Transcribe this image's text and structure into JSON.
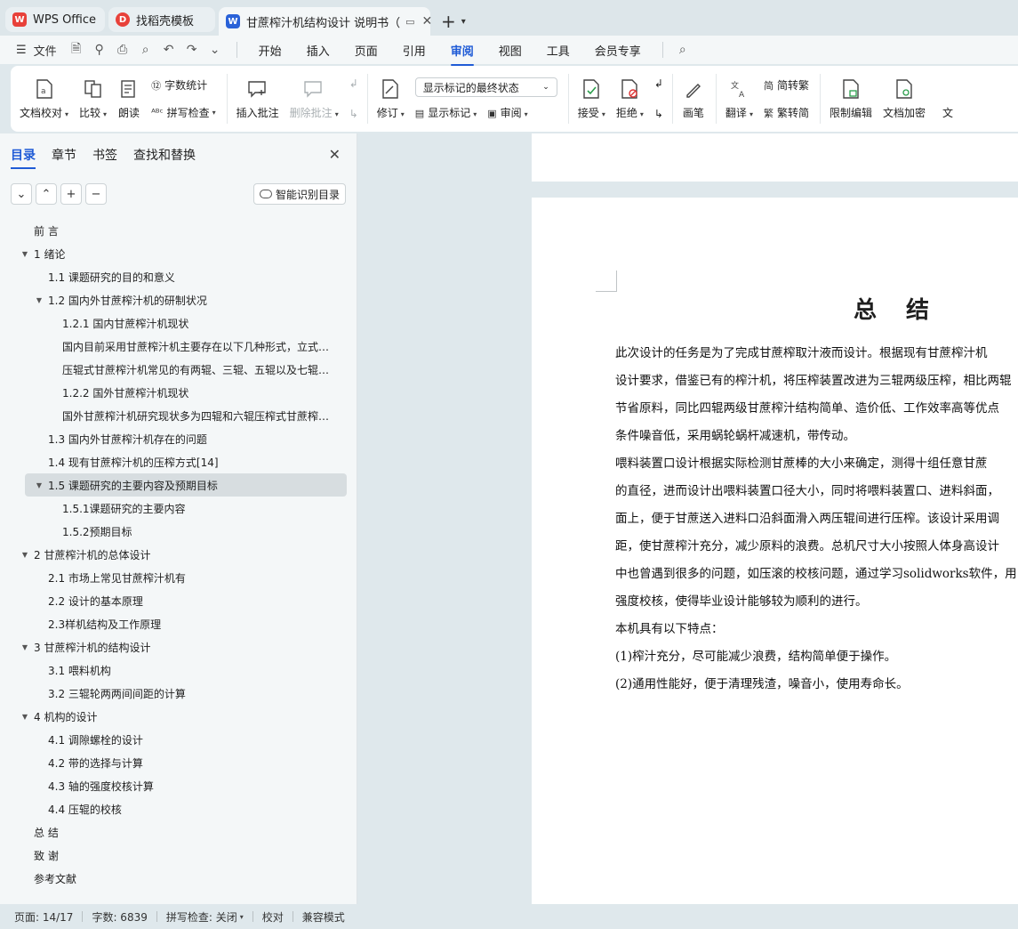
{
  "tabs": [
    {
      "label": "WPS Office",
      "icon": "wps-logo-icon"
    },
    {
      "label": "找稻壳模板",
      "icon": "daoke-logo-icon"
    },
    {
      "label": "甘蔗榨汁机结构设计 说明书（",
      "icon": "word-doc-icon"
    }
  ],
  "menu": {
    "file_label": "文件",
    "tabs": [
      "开始",
      "插入",
      "页面",
      "引用",
      "审阅",
      "视图",
      "工具",
      "会员专享"
    ],
    "active_tab": "审阅"
  },
  "ribbon": {
    "doc_check": "文档校对",
    "compare": "比较",
    "read_aloud": "朗读",
    "word_count": "字数统计",
    "spell_check": "拼写检查",
    "insert_comment": "插入批注",
    "delete_comment": "删除批注",
    "display_state": "显示标记的最终状态",
    "revise": "修订",
    "show_markup": "显示标记",
    "review": "审阅",
    "accept": "接受",
    "reject": "拒绝",
    "pen": "画笔",
    "translate": "翻译",
    "to_traditional": "简转繁",
    "to_simplified": "繁转简",
    "restrict_edit": "限制编辑",
    "encrypt": "文档加密",
    "more": "文"
  },
  "leftpane": {
    "tabs": [
      "目录",
      "章节",
      "书签",
      "查找和替换"
    ],
    "active_tab": "目录",
    "ai_button": "智能识别目录",
    "toc": [
      {
        "text": "前  言",
        "level": 1,
        "arrow": false
      },
      {
        "text": "1 绪论",
        "level": 1,
        "arrow": true
      },
      {
        "text": "1.1 课题研究的目的和意义",
        "level": 2,
        "arrow": false
      },
      {
        "text": "1.2 国内外甘蔗榨汁机的研制状况",
        "level": 2,
        "arrow": true
      },
      {
        "text": "1.2.1 国内甘蔗榨汁机现状",
        "level": 3,
        "arrow": false
      },
      {
        "text": "国内目前采用甘蔗榨汁机主要存在以下几种形式，立式…",
        "level": 3,
        "arrow": false
      },
      {
        "text": "压辊式甘蔗榨汁机常见的有两辊、三辊、五辊以及七辊…",
        "level": 3,
        "arrow": false
      },
      {
        "text": "1.2.2  国外甘蔗榨汁机现状",
        "level": 3,
        "arrow": false
      },
      {
        "text": "国外甘蔗榨汁机研究现状多为四辊和六辊压榨式甘蔗榨…",
        "level": 3,
        "arrow": false
      },
      {
        "text": "1.3 国内外甘蔗榨汁机存在的问题",
        "level": 2,
        "arrow": false
      },
      {
        "text": "1.4 现有甘蔗榨汁机的压榨方式[14]",
        "level": 2,
        "arrow": false
      },
      {
        "text": "1.5 课题研究的主要内容及预期目标",
        "level": 2,
        "arrow": true,
        "selected": true
      },
      {
        "text": "1.5.1课题研究的主要内容",
        "level": 3,
        "arrow": false
      },
      {
        "text": "1.5.2预期目标",
        "level": 3,
        "arrow": false
      },
      {
        "text": "2 甘蔗榨汁机的总体设计",
        "level": 1,
        "arrow": true
      },
      {
        "text": "2.1 市场上常见甘蔗榨汁机有",
        "level": 2,
        "arrow": false
      },
      {
        "text": "2.2 设计的基本原理",
        "level": 2,
        "arrow": false
      },
      {
        "text": "2.3样机结构及工作原理",
        "level": 2,
        "arrow": false
      },
      {
        "text": "3 甘蔗榨汁机的结构设计",
        "level": 1,
        "arrow": true
      },
      {
        "text": "3.1 喂料机构",
        "level": 2,
        "arrow": false
      },
      {
        "text": "3.2 三辊轮两两间间距的计算",
        "level": 2,
        "arrow": false
      },
      {
        "text": "4 机构的设计",
        "level": 1,
        "arrow": true
      },
      {
        "text": "4.1 调隙螺栓的设计",
        "level": 2,
        "arrow": false
      },
      {
        "text": "4.2 带的选择与计算",
        "level": 2,
        "arrow": false
      },
      {
        "text": "4.3 轴的强度校核计算",
        "level": 2,
        "arrow": false
      },
      {
        "text": "4.4 压辊的校核",
        "level": 2,
        "arrow": false
      },
      {
        "text": "总  结",
        "level": 1,
        "arrow": false
      },
      {
        "text": "致  谢",
        "level": 1,
        "arrow": false
      },
      {
        "text": "参考文献",
        "level": 1,
        "arrow": false
      }
    ]
  },
  "document": {
    "title": "总  结",
    "lines": [
      "      此次设计的任务是为了完成甘蔗榨取汁液而设计。根据现有甘蔗榨汁机",
      "设计要求，借鉴已有的榨汁机，将压榨装置改进为三辊两级压榨，相比两辊",
      "节省原料，同比四辊两级甘蔗榨汁结构简单、造价低、工作效率高等优点",
      "条件噪音低，采用蜗轮蜗杆减速机，带传动。",
      "      喂料装置口设计根据实际检测甘蔗棒的大小来确定，测得十组任意甘蔗",
      "的直径，进而设计出喂料装置口径大小，同时将喂料装置口、进料斜面，",
      "面上，便于甘蔗送入进料口沿斜面滑入两压辊间进行压榨。该设计采用调",
      "距，使甘蔗榨汁充分，减少原料的浪费。总机尺寸大小按照人体身高设计",
      "中也曾遇到很多的问题，如压滚的校核问题，通过学习solidworks软件，用",
      "强度校核，使得毕业设计能够较为顺利的进行。",
      "      本机具有以下特点：",
      "      (1)榨汁充分，尽可能减少浪费，结构简单便于操作。",
      "      (2)通用性能好，便于清理残渣，噪音小，使用寿命长。"
    ]
  },
  "status": {
    "page": "页面: 14/17",
    "words": "字数: 6839",
    "spell": "拼写检查: 关闭",
    "proof": "校对",
    "compat": "兼容模式"
  },
  "colors": {
    "accent": "#1f5bd6",
    "wps_red": "#e8413a",
    "word_blue": "#2a62d8"
  }
}
